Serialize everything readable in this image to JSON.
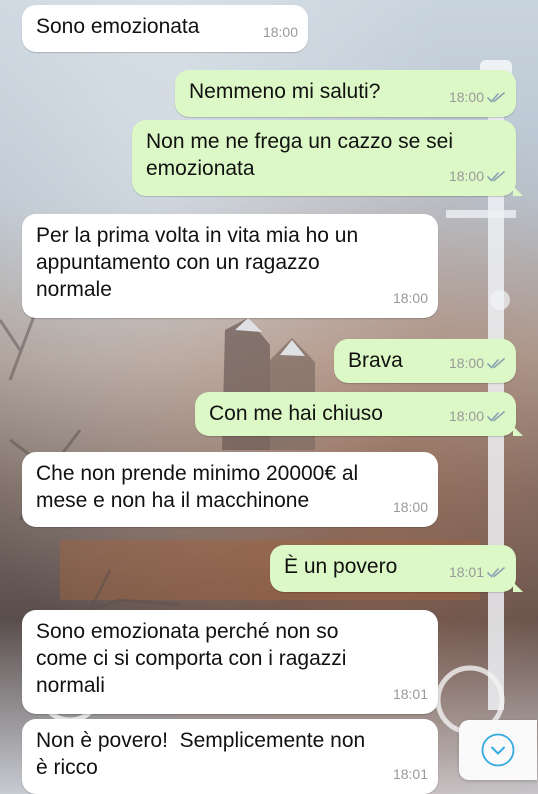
{
  "messages": [
    {
      "dir": "in",
      "text": "Sono emozionata",
      "time": "18:00"
    },
    {
      "dir": "out",
      "text": "Nemmeno mi saluti?",
      "time": "18:00",
      "read": true
    },
    {
      "dir": "out",
      "text": "Non me ne frega un cazzo se sei\nemozionata",
      "time": "18:00",
      "read": true
    },
    {
      "dir": "in",
      "text": "Per la prima volta in vita mia ho un\nappuntamento con un ragazzo\nnormale",
      "time": "18:00"
    },
    {
      "dir": "out",
      "text": "Brava",
      "time": "18:00",
      "read": true
    },
    {
      "dir": "out",
      "text": "Con me hai chiuso",
      "time": "18:00",
      "read": true
    },
    {
      "dir": "in",
      "text": "Che non prende minimo 20000€ al\nmese e non ha il macchinone",
      "time": "18:00"
    },
    {
      "dir": "out",
      "text": "È un povero",
      "time": "18:01",
      "read": true
    },
    {
      "dir": "in",
      "text": "Sono emozionata perché non so\ncome ci si comporta con i ragazzi\nnormali",
      "time": "18:01"
    },
    {
      "dir": "in",
      "text": "Non è povero!  Semplicemente non\nè ricco",
      "time": "18:01"
    }
  ],
  "colors": {
    "incoming": "#ffffff",
    "outgoing": "#dcf8c6",
    "tick": "#8aa3b3",
    "accent": "#34aadf"
  },
  "scroll_button": {
    "icon": "chevron-down-circle-icon"
  }
}
